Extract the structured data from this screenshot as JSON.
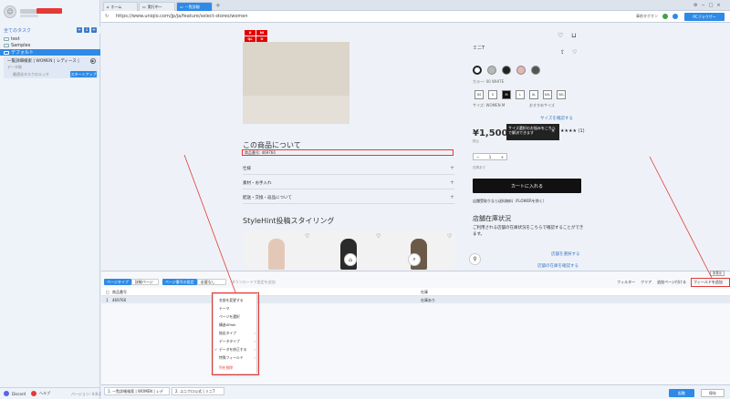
{
  "sidebar": {
    "tree_header": "全てのタスク",
    "items": [
      {
        "label": "test"
      },
      {
        "label": "Samples"
      },
      {
        "label": "デフォルト"
      }
    ],
    "task": {
      "title": "一覧詳細検索 | WOMEN | レディース |",
      "sub": "データ取",
      "sub2": "最適化タスクのエッチ",
      "run_label": "スタートアップ"
    },
    "footer": {
      "a": "Discord",
      "b": "ヘルプ"
    },
    "version": "バージョン: 4.8.2"
  },
  "browser": {
    "tabs": [
      {
        "label": "ホーム"
      },
      {
        "label": "実行中ー"
      },
      {
        "label": "一覧詳細"
      }
    ],
    "url": "https://www.uniqlo.com/jp/ja/feature/select-stores/women",
    "right_tools": "事前タグオン",
    "primary_button": "PCブラウザー"
  },
  "webpage": {
    "logo": [
      "U",
      "NI",
      "QL",
      "O"
    ],
    "product_name": "ミニT",
    "color_label": "カラー: 00 WHITE",
    "sizes": [
      "XS",
      "S",
      "M",
      "L",
      "XL",
      "XXL",
      "3XL"
    ],
    "size_label": "サイズ: WOMEN M",
    "size_right": "おすすめサイズ",
    "size_check": "サイズを確認する",
    "price": "¥1,500",
    "price_sub": "税込",
    "tooltip": "サイズ選択のお悩みをこちらで解決できます",
    "tooltip_close": "×",
    "stars": "★★★★ (1)",
    "qty_minus": "−",
    "qty_value": "1",
    "qty_plus": "+",
    "stock_info": "在庫あり",
    "cart_button": "カートに入れる",
    "shipping_note": "店舗受取りなら送料無料（FLOWERを除く）",
    "about_title": "この商品について",
    "product_code": "商品番号: 469760",
    "accordions": [
      "仕様",
      "素材・お手入れ",
      "配送・交換・返品について"
    ],
    "stylehint_title": "StyleHint投稿スタイリング",
    "store_title": "店舗在庫状況",
    "store_desc": "ご利用される店舗の在庫状況をこちらで確認することができます。",
    "store_link1": "店舗を選択する",
    "store_link2": "店舗の在庫を確認する"
  },
  "bottom": {
    "badge": "非表示",
    "page_type_label": "ページタイプ",
    "page_type_value": "詳細ページ",
    "page_rule_label": "ページ番号の設定",
    "page_rule_value": "必要なし",
    "hint": "ダウンロードで設定を追加",
    "tools": [
      "フィルター",
      "クリア",
      "追加ページ付ける"
    ],
    "add_field": "フィールドを追加",
    "columns": [
      "商品番号",
      "在庫"
    ],
    "row": {
      "index": "1",
      "code": "469760",
      "stock": "在庫あり"
    }
  },
  "context_menu": {
    "items": [
      {
        "label": "名前を変更する",
        "arrow": ""
      },
      {
        "label": "テーマ",
        "arrow": ""
      },
      {
        "label": "ページを選択",
        "arrow": ""
      },
      {
        "label": "構造XPath",
        "arrow": ""
      },
      {
        "label": "抽出タイプ",
        "arrow": "›"
      },
      {
        "label": "データタイプ",
        "arrow": "›"
      },
      {
        "label": "データを修正する",
        "arrow": "›",
        "check": "✓"
      },
      {
        "label": "特殊フィールド",
        "arrow": "›"
      },
      {
        "label": "列を削除",
        "arrow": ""
      }
    ]
  },
  "footer": {
    "tabs": [
      "1. 一覧詳細検索 | WOMEN | レデ",
      "2. ユニクロ公式 | ミニT"
    ],
    "start": "起動",
    "save": "保存"
  }
}
